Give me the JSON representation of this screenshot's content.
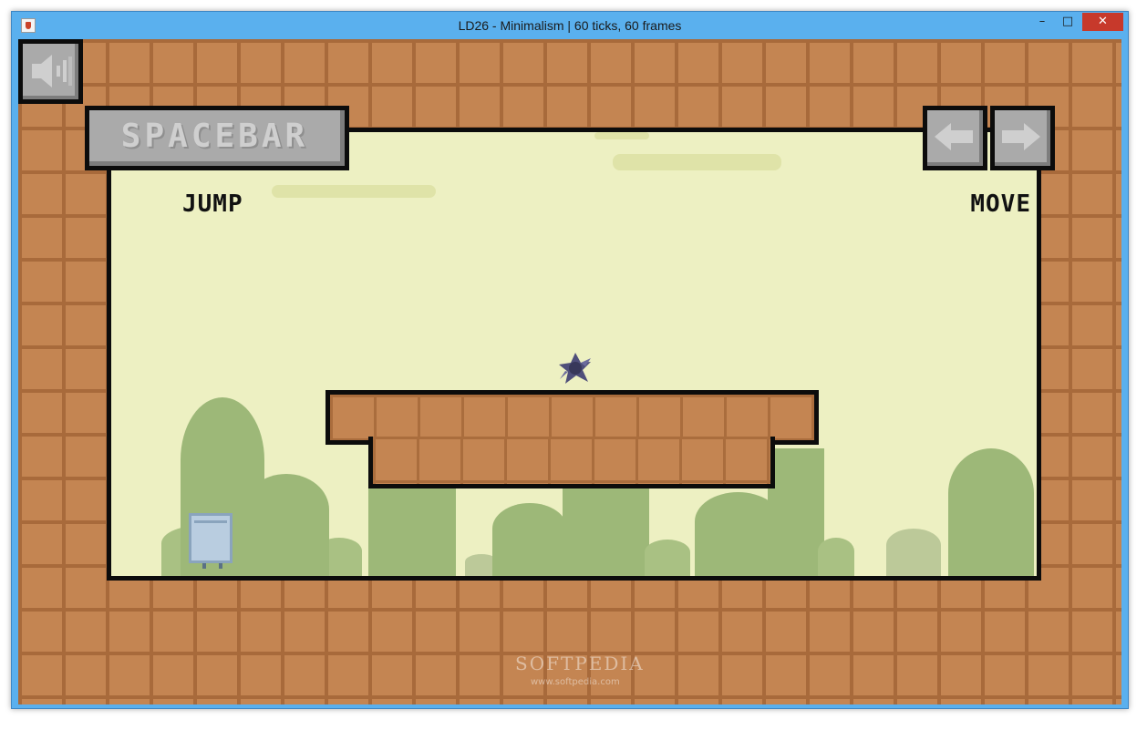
{
  "window": {
    "title": "LD26 - Minimalism | 60 ticks, 60 frames",
    "minimize_glyph": "–",
    "maximize_glyph": "□",
    "close_glyph": "✕"
  },
  "hud": {
    "jump_key_label": "SPACEBAR",
    "jump_hint": "JUMP",
    "move_hint": "MOVE",
    "sound_icon": "speaker-icon",
    "left_icon": "arrow-left-icon",
    "right_icon": "arrow-right-icon"
  },
  "watermark": {
    "brand": "SOFTPEDIA",
    "url": "www.softpedia.com"
  },
  "colors": {
    "titlebar": "#5ab0ee",
    "brick": "#c48552",
    "brick_grout": "#a86a3b",
    "sky": "#edf0c2",
    "hill": "#9db878",
    "key_face": "#aaaaaa",
    "close_button": "#c7392b",
    "player": "#4f4f7a",
    "door": "#b9cde0"
  }
}
